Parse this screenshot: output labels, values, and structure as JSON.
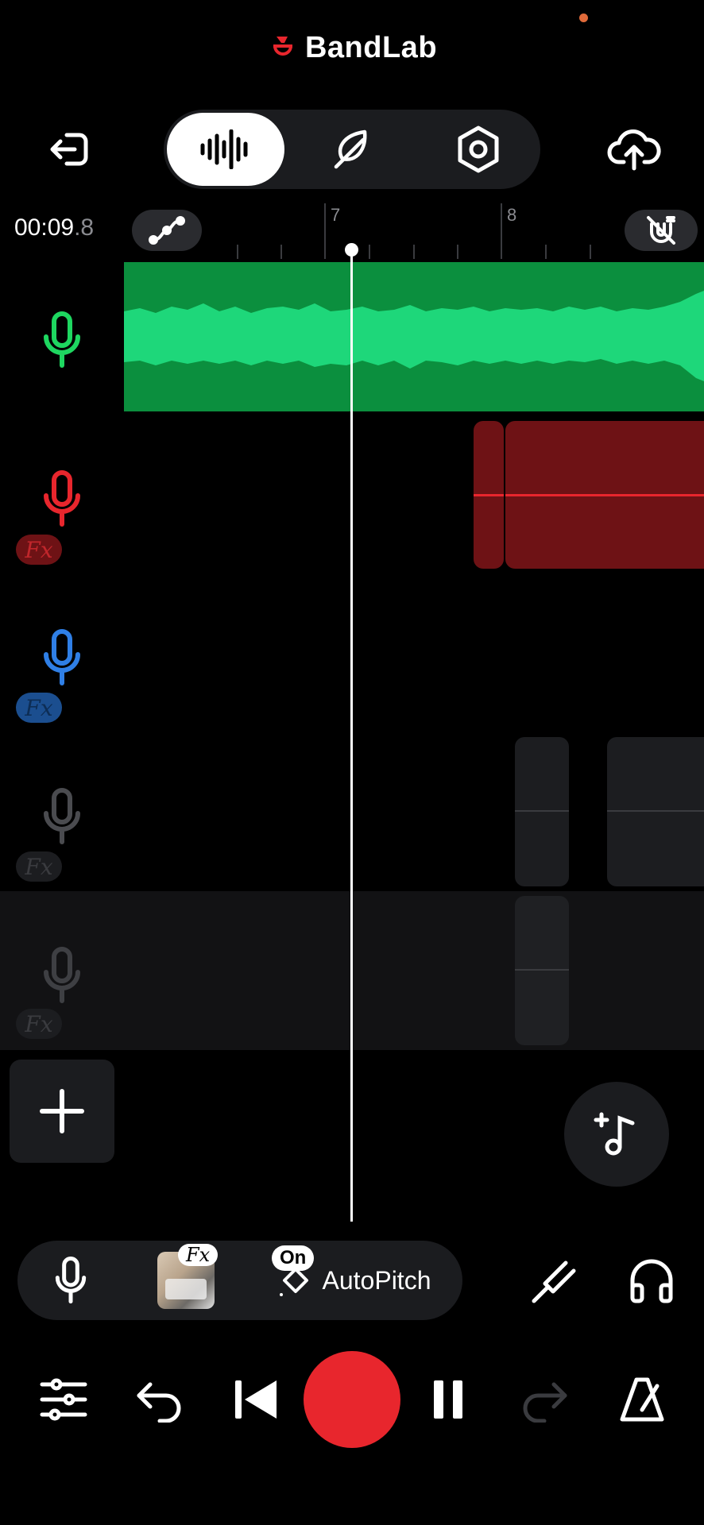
{
  "app": {
    "brand": "BandLab"
  },
  "header": {
    "back_icon": "exit-icon",
    "tabs": [
      {
        "name": "waveform",
        "icon": "waveform-icon",
        "active": true
      },
      {
        "name": "instruments",
        "icon": "feather-icon",
        "active": false
      },
      {
        "name": "settings",
        "icon": "hex-nut-icon",
        "active": false
      }
    ],
    "upload_icon": "cloud-upload-icon"
  },
  "timeline": {
    "time_main": "00:09",
    "time_frac": ".8",
    "bars": [
      "7",
      "8"
    ],
    "automation_icon": "automation-curve-icon",
    "magnet_icon": "magnet-off-icon"
  },
  "tracks": [
    {
      "color": "#1ed760",
      "fx": false
    },
    {
      "color": "#e8262d",
      "fx": true,
      "fx_label": "Fx"
    },
    {
      "color": "#2f7fe6",
      "fx": true,
      "fx_label": "Fx"
    },
    {
      "color": "#4a4b4f",
      "fx": true,
      "fx_label": "Fx"
    },
    {
      "color": "#4a4b4f",
      "fx": true,
      "fx_label": "Fx"
    }
  ],
  "actions": {
    "add_track_icon": "plus-icon",
    "add_instrument_icon": "add-music-note-icon"
  },
  "record_bar": {
    "mic_icon": "microphone-icon",
    "fx_label": "Fx",
    "on_label": "On",
    "autopitch_label": "AutoPitch",
    "tuner_icon": "tuning-fork-icon",
    "headphones_icon": "headphones-icon"
  },
  "transport": {
    "mixer_icon": "sliders-icon",
    "undo_icon": "undo-icon",
    "rewind_icon": "skip-back-icon",
    "record_icon": "record-button",
    "pause_icon": "pause-icon",
    "redo_icon": "redo-icon",
    "metronome_icon": "metronome-icon",
    "record_color": "#e8262d"
  }
}
